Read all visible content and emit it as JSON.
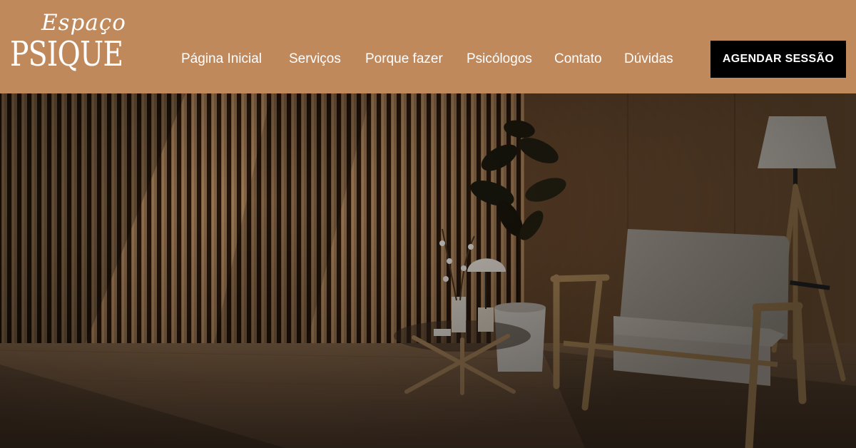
{
  "brand": {
    "line1": "Espaço",
    "line2": "PSIQUE"
  },
  "nav": [
    {
      "label": "Página Inicial"
    },
    {
      "label": "Serviços"
    },
    {
      "label": "Porque fazer"
    },
    {
      "label": "Psicólogos"
    },
    {
      "label": "Contato"
    },
    {
      "label": "Dúvidas"
    }
  ],
  "cta": {
    "label": "AGENDAR SESSÃO"
  },
  "colors": {
    "header_bg": "#c0895c",
    "cta_bg": "#000000",
    "text": "#ffffff"
  }
}
